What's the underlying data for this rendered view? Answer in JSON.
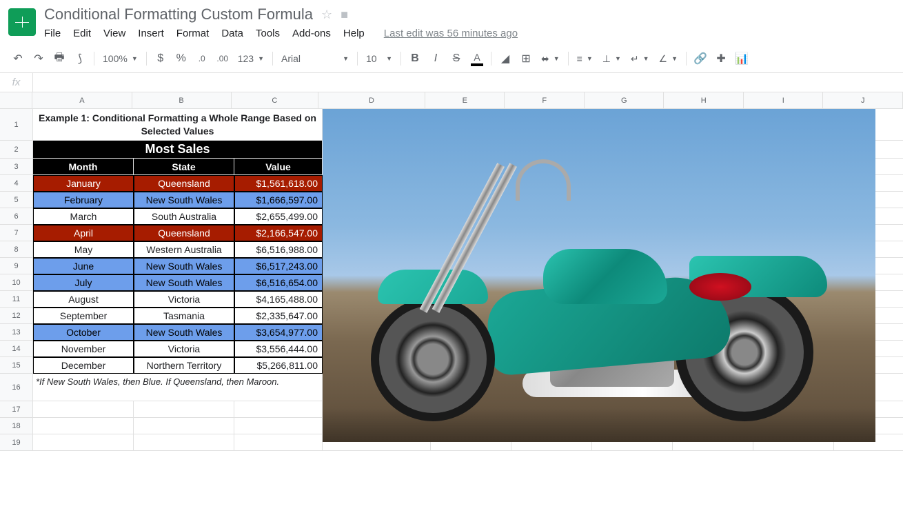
{
  "doc_title": "Conditional Formatting Custom Formula",
  "menu": {
    "file": "File",
    "edit": "Edit",
    "view": "View",
    "insert": "Insert",
    "format": "Format",
    "data": "Data",
    "tools": "Tools",
    "addons": "Add-ons",
    "help": "Help"
  },
  "last_edit": "Last edit was 56 minutes ago",
  "toolbar": {
    "zoom": "100%",
    "font": "Arial",
    "font_size": "10",
    "more_formats": "123"
  },
  "fx_label": "fx",
  "columns": {
    "A": 146,
    "B": 146,
    "C": 128,
    "D": 157,
    "E": 117,
    "F": 117,
    "G": 117,
    "H": 117,
    "I": 117,
    "J": 117
  },
  "sheet": {
    "example_title": "Example 1: Conditional Formatting a Whole Range Based on Selected Values",
    "most_sales": "Most Sales",
    "headers": {
      "month": "Month",
      "state": "State",
      "value": "Value"
    },
    "rows": [
      {
        "month": "January",
        "state": "Queensland",
        "value": "$1,561,618.00",
        "hl": "maroon"
      },
      {
        "month": "February",
        "state": "New South Wales",
        "value": "$1,666,597.00",
        "hl": "blue"
      },
      {
        "month": "March",
        "state": "South Australia",
        "value": "$2,655,499.00",
        "hl": ""
      },
      {
        "month": "April",
        "state": "Queensland",
        "value": "$2,166,547.00",
        "hl": "maroon"
      },
      {
        "month": "May",
        "state": "Western Australia",
        "value": "$6,516,988.00",
        "hl": ""
      },
      {
        "month": "June",
        "state": "New South Wales",
        "value": "$6,517,243.00",
        "hl": "blue"
      },
      {
        "month": "July",
        "state": "New South Wales",
        "value": "$6,516,654.00",
        "hl": "blue"
      },
      {
        "month": "August",
        "state": "Victoria",
        "value": "$4,165,488.00",
        "hl": ""
      },
      {
        "month": "September",
        "state": "Tasmania",
        "value": "$2,335,647.00",
        "hl": ""
      },
      {
        "month": "October",
        "state": "New South Wales",
        "value": "$3,654,977.00",
        "hl": "blue"
      },
      {
        "month": "November",
        "state": "Victoria",
        "value": "$3,556,444.00",
        "hl": ""
      },
      {
        "month": "December",
        "state": "Northern Territory",
        "value": "$5,266,811.00",
        "hl": ""
      }
    ],
    "note": "*If New South Wales, then Blue. If Queensland, then Maroon."
  },
  "row_heights": {
    "title": 46,
    "most_sales": 26,
    "header": 24,
    "data": 24,
    "note": 40,
    "default": 24
  }
}
